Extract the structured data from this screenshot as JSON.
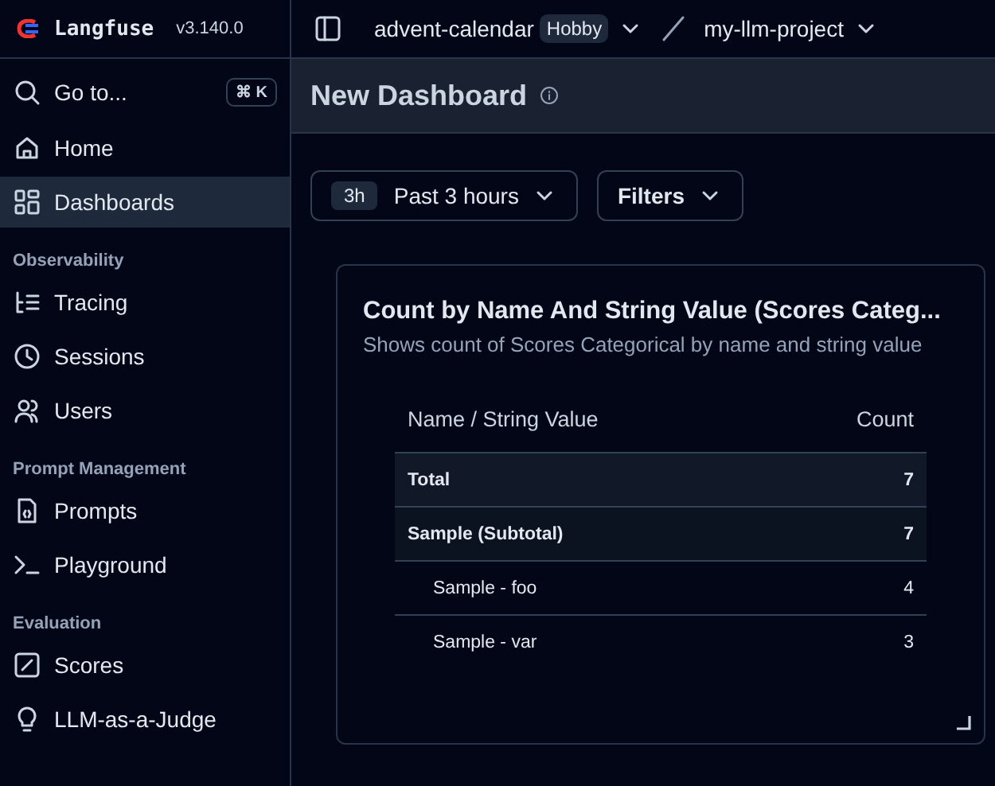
{
  "app": {
    "name": "Langfuse",
    "version": "v3.140.0"
  },
  "breadcrumb": {
    "organization": "advent-calendar",
    "plan": "Hobby",
    "project": "my-llm-project"
  },
  "search": {
    "label": "Go to...",
    "shortcut": "⌘ K"
  },
  "sidebar": {
    "items": [
      {
        "kind": "item",
        "label": "Home",
        "selected": false
      },
      {
        "kind": "item",
        "label": "Dashboards",
        "selected": true
      },
      {
        "kind": "section",
        "label": "Observability"
      },
      {
        "kind": "item",
        "label": "Tracing",
        "selected": false
      },
      {
        "kind": "item",
        "label": "Sessions",
        "selected": false
      },
      {
        "kind": "item",
        "label": "Users",
        "selected": false
      },
      {
        "kind": "section",
        "label": "Prompt Management"
      },
      {
        "kind": "item",
        "label": "Prompts",
        "selected": false
      },
      {
        "kind": "item",
        "label": "Playground",
        "selected": false
      },
      {
        "kind": "section",
        "label": "Evaluation"
      },
      {
        "kind": "item",
        "label": "Scores",
        "selected": false
      },
      {
        "kind": "item",
        "label": "LLM-as-a-Judge",
        "selected": false
      }
    ]
  },
  "page": {
    "title": "New Dashboard"
  },
  "filters": {
    "range_badge": "3h",
    "range_label": "Past 3 hours",
    "filters_label": "Filters"
  },
  "widget": {
    "title": "Count by Name And String Value (Scores Categ...",
    "description": "Shows count of Scores Categorical by name and string value",
    "columns": [
      "Name / String Value",
      "Count"
    ],
    "rows": [
      {
        "kind": "total",
        "name": "Total",
        "count": "7"
      },
      {
        "kind": "subtotal",
        "name": "Sample (Subtotal)",
        "count": "7"
      },
      {
        "kind": "leaf",
        "name": "Sample - foo",
        "count": "4"
      },
      {
        "kind": "leaf",
        "name": "Sample - var",
        "count": "3"
      }
    ]
  }
}
